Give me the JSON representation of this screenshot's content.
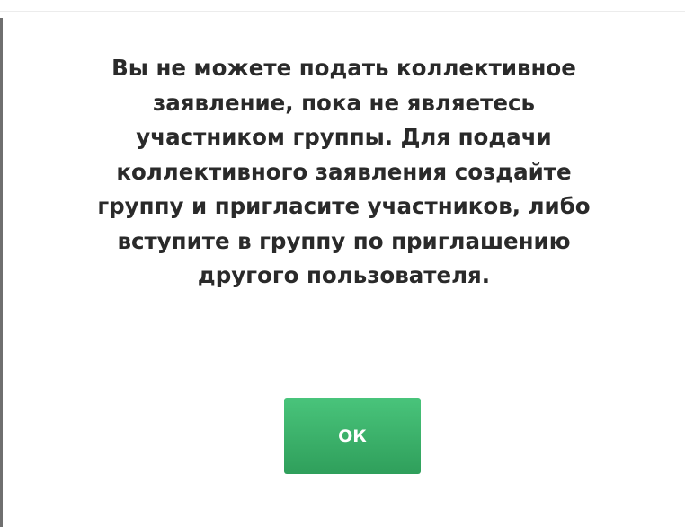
{
  "dialog": {
    "message_lines": [
      "Вы не можете подать коллективное",
      "заявление, пока не являетесь",
      "участником группы. Для подачи",
      "коллективного заявления создайте",
      "группу и пригласите участников, либо",
      "вступите в группу по приглашению",
      "другого пользователя."
    ],
    "ok_label": "ОК"
  },
  "colors": {
    "button_top": "#49c47b",
    "button_bottom": "#2f9f5b",
    "text": "#2a2a2a",
    "background": "#ffffff"
  }
}
